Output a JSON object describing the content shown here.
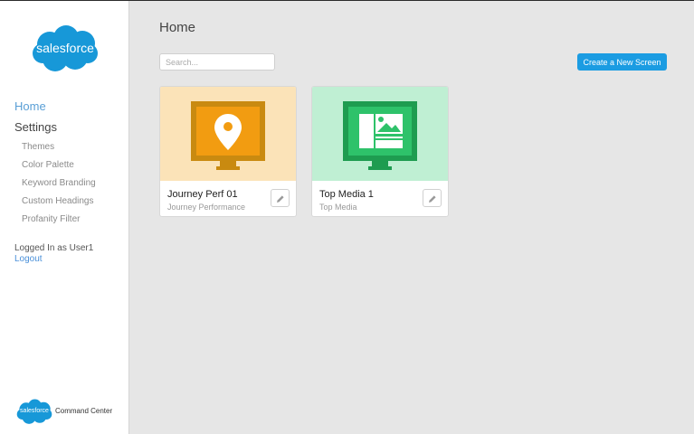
{
  "sidebar": {
    "logo_text": "salesforce",
    "nav": {
      "home": "Home",
      "settings": "Settings"
    },
    "settings_items": [
      "Themes",
      "Color Palette",
      "Keyword Branding",
      "Custom Headings",
      "Profanity Filter"
    ],
    "logged_in": "Logged In as User1",
    "logout": "Logout",
    "footer_logo_text": "salesforce",
    "footer_label": "Command Center"
  },
  "main": {
    "title": "Home",
    "search_placeholder": "Search...",
    "create_button": "Create a New Screen",
    "cards": [
      {
        "title": "Journey Perf 01",
        "subtitle": "Journey Performance",
        "icon": "location-pin-icon",
        "bg": "#fbe3b8",
        "frame": "#c98a10",
        "screen": "#f29c11"
      },
      {
        "title": "Top Media 1",
        "subtitle": "Top Media",
        "icon": "media-layout-icon",
        "bg": "#bfefd3",
        "frame": "#1e9c50",
        "screen": "#2ec26a"
      }
    ]
  },
  "colors": {
    "accent": "#1b9ce2",
    "brand_blue": "#1798d8",
    "home_link": "#5a9fd6"
  }
}
